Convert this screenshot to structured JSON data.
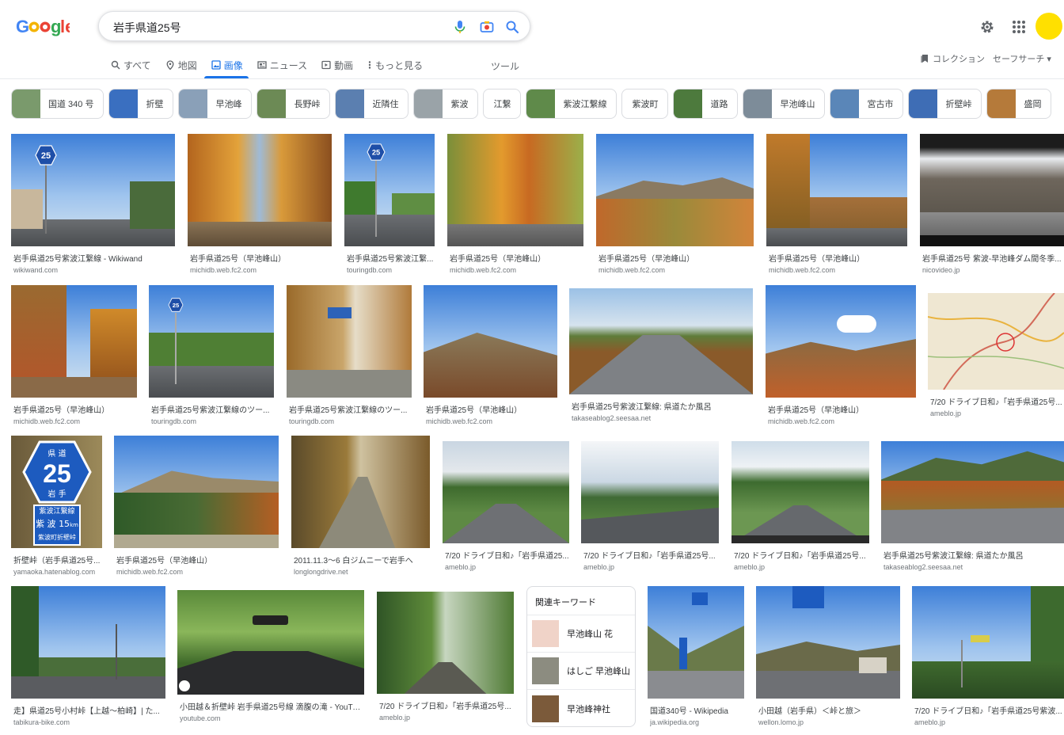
{
  "header": {
    "logo_text": "Google",
    "search_query": "岩手県道25号",
    "collection_label": "コレクション",
    "safesearch_label": "セーフサーチ ▾",
    "tools_label": "ツール"
  },
  "tabs": [
    {
      "label": "すべて",
      "icon": "search-icon"
    },
    {
      "label": "地図",
      "icon": "map-pin-icon"
    },
    {
      "label": "画像",
      "icon": "image-icon",
      "active": true
    },
    {
      "label": "ニュース",
      "icon": "news-icon"
    },
    {
      "label": "動画",
      "icon": "video-icon"
    },
    {
      "label": "もっと見る",
      "icon": "more-vert-icon"
    }
  ],
  "chips": [
    {
      "label": "国道 340 号",
      "thumb_color": "#7a9a6c"
    },
    {
      "label": "折壁",
      "thumb_color": "#3a6fc0"
    },
    {
      "label": "早池峰",
      "thumb_color": "#8aa0b8"
    },
    {
      "label": "長野峠",
      "thumb_color": "#6c8a55"
    },
    {
      "label": "近隣住",
      "thumb_color": "#5b7fb0"
    },
    {
      "label": "紫波",
      "thumb_color": "#9aa3a8"
    },
    {
      "label": "江繋",
      "thumb_color": null
    },
    {
      "label": "紫波江繋線",
      "thumb_color": "#5f8a4a"
    },
    {
      "label": "紫波町",
      "thumb_color": null
    },
    {
      "label": "道路",
      "thumb_color": "#4d7a3d"
    },
    {
      "label": "早池峰山",
      "thumb_color": "#7d8c99"
    },
    {
      "label": "宮古市",
      "thumb_color": "#5a86b8"
    },
    {
      "label": "折壁峠",
      "thumb_color": "#3e6db5"
    },
    {
      "label": "盛岡",
      "thumb_color": "#b57a3a"
    }
  ],
  "results": [
    {
      "title": "岩手県道25号紫波江繋線 - Wikiwand",
      "source": "wikiwand.com"
    },
    {
      "title": "岩手県道25号（早池峰山）",
      "source": "michidb.web.fc2.com"
    },
    {
      "title": "岩手県道25号紫波江繋...",
      "source": "touringdb.com"
    },
    {
      "title": "岩手県道25号（早池峰山）",
      "source": "michidb.web.fc2.com"
    },
    {
      "title": "岩手県道25号（早池峰山）",
      "source": "michidb.web.fc2.com"
    },
    {
      "title": "岩手県道25号（早池峰山）",
      "source": "michidb.web.fc2.com"
    },
    {
      "title": "岩手県道25号 紫波-早池峰ダム間冬季...",
      "source": "nicovideo.jp"
    },
    {
      "title": "岩手県道25号（早池峰山）",
      "source": "michidb.web.fc2.com"
    },
    {
      "title": "岩手県道25号紫波江繋線のツー...",
      "source": "touringdb.com"
    },
    {
      "title": "岩手県道25号紫波江繋線のツー...",
      "source": "touringdb.com"
    },
    {
      "title": "岩手県道25号（早池峰山）",
      "source": "michidb.web.fc2.com"
    },
    {
      "title": "岩手県道25号紫波江繋線: 県道たか風呂",
      "source": "takaseablog2.seesaa.net"
    },
    {
      "title": "岩手県道25号（早池峰山）",
      "source": "michidb.web.fc2.com"
    },
    {
      "title": "7/20 ドライブ日和♪「岩手県道25号...",
      "source": "ameblo.jp"
    },
    {
      "title": "折壁峠（岩手県道25号...",
      "source": "yamaoka.hatenablog.com"
    },
    {
      "title": "岩手県道25号（早池峰山）",
      "source": "michidb.web.fc2.com"
    },
    {
      "title": "2011.11.3〜6 白ジムニーで岩手へ",
      "source": "longlongdrive.net"
    },
    {
      "title": "7/20 ドライブ日和♪「岩手県道25...",
      "source": "ameblo.jp"
    },
    {
      "title": "7/20 ドライブ日和♪「岩手県道25号...",
      "source": "ameblo.jp"
    },
    {
      "title": "7/20 ドライブ日和♪「岩手県道25号...",
      "source": "ameblo.jp"
    },
    {
      "title": "岩手県道25号紫波江繋線: 県道たか風呂",
      "source": "takaseablog2.seesaa.net"
    },
    {
      "title": "走】県道25号小村峠【上越〜柏崎】| た...",
      "source": "tabikura-bike.com"
    },
    {
      "title": "小田越＆折壁峠 岩手県道25号線 滴腹の滝 - YouTube",
      "source": "youtube.com"
    },
    {
      "title": "7/20 ドライブ日和♪「岩手県道25号...",
      "source": "ameblo.jp"
    },
    {
      "title": "国道340号 - Wikipedia",
      "source": "ja.wikipedia.org"
    },
    {
      "title": "小田越（岩手県）＜峠と旅＞",
      "source": "wellon.lomo.jp"
    },
    {
      "title": "7/20 ドライブ日和♪「岩手県道25号紫波...",
      "source": "ameblo.jp"
    }
  ],
  "sign_text": {
    "route_number": "25",
    "pref_top": "県 道",
    "pref_bottom": "岩 手",
    "route_name": "紫波江繋線",
    "town": "紫 波",
    "distance": "15",
    "distance_unit": "km",
    "town_label": "紫波町折壁峠"
  },
  "related": {
    "header": "関連キーワード",
    "items": [
      {
        "label": "早池峰山 花",
        "thumb_color": "#f0d3c8"
      },
      {
        "label": "はしご 早池峰山",
        "thumb_color": "#8c8c80"
      },
      {
        "label": "早池峰神社",
        "thumb_color": "#7b5a3a"
      }
    ]
  }
}
